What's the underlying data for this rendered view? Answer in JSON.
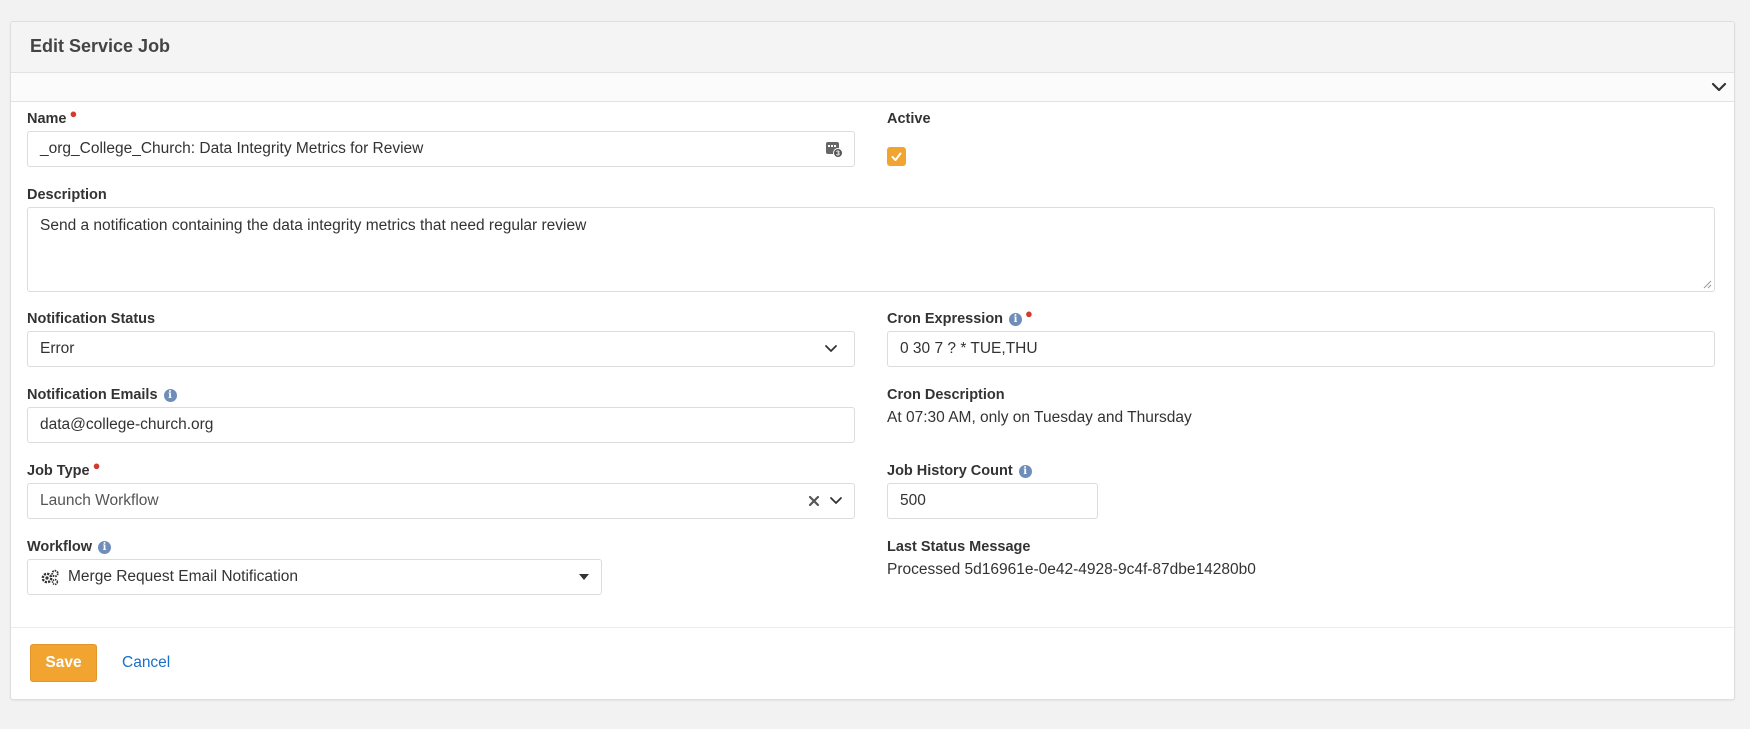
{
  "panel": {
    "title": "Edit Service Job"
  },
  "form": {
    "name": {
      "label": "Name",
      "value": "_org_College_Church: Data Integrity Metrics for Review"
    },
    "active": {
      "label": "Active",
      "checked": true
    },
    "description": {
      "label": "Description",
      "value": "Send a notification containing the data integrity metrics that need regular review"
    },
    "notification_status": {
      "label": "Notification Status",
      "value": "Error"
    },
    "cron_expression": {
      "label": "Cron Expression",
      "value": "0 30 7 ? * TUE,THU"
    },
    "notification_emails": {
      "label": "Notification Emails",
      "value": "data@college-church.org"
    },
    "cron_description": {
      "label": "Cron Description",
      "value": "At 07:30 AM, only on Tuesday and Thursday"
    },
    "job_type": {
      "label": "Job Type",
      "value": "Launch Workflow"
    },
    "job_history_count": {
      "label": "Job History Count",
      "value": "500"
    },
    "workflow": {
      "label": "Workflow",
      "value": "Merge Request Email Notification"
    },
    "last_status_message": {
      "label": "Last Status Message",
      "value": "Processed 5d16961e-0e42-4928-9c4f-87dbe14280b0"
    }
  },
  "actions": {
    "save_label": "Save",
    "cancel_label": "Cancel"
  },
  "colors": {
    "accent": "#f1a530",
    "link": "#1a6fc9",
    "required": "#d43a2f",
    "info": "#6f8db9"
  },
  "icons": {
    "drawer_toggle": "chevron-down-icon",
    "name_field_addon": "merge-field-icon",
    "info": "info-icon",
    "clear": "close-icon",
    "workflow": "gears-icon"
  }
}
